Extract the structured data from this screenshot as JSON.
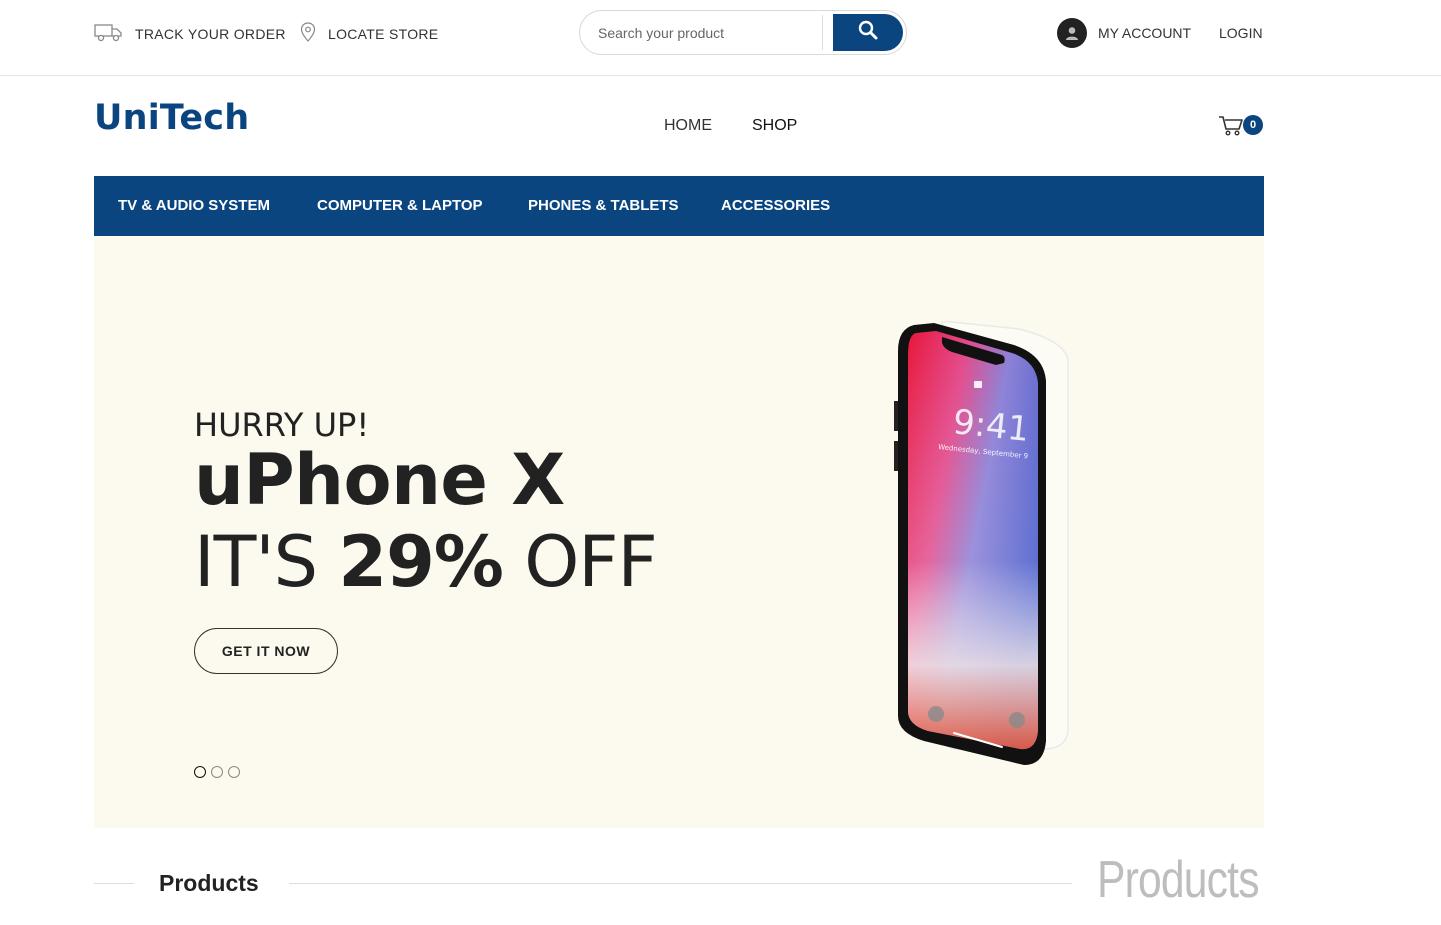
{
  "topbar": {
    "track_order": "TRACK YOUR ORDER",
    "locate_store": "LOCATE STORE",
    "search_placeholder": "Search your product",
    "my_account": "MY ACCOUNT",
    "login": "LOGIN"
  },
  "header": {
    "logo": "UniTech",
    "nav": [
      "HOME",
      "SHOP"
    ],
    "cart_count": "0"
  },
  "categories": [
    "TV & AUDIO SYSTEM",
    "COMPUTER & LAPTOP",
    "PHONES & TABLETS",
    "ACCESSORIES"
  ],
  "hero": {
    "pre_title": "HURRY UP!",
    "title": "uPhone X",
    "offer_prefix": "IT'S",
    "offer_highlight": "29%",
    "offer_suffix": "OFF",
    "cta": "GET IT NOW",
    "phone_time": "9:41",
    "phone_date": "Wednesday, September 9",
    "slides_count": 3,
    "active_slide": 1,
    "background": "#fcfaee"
  },
  "section": {
    "title": "Products",
    "ghost_title": "Products"
  },
  "colors": {
    "brand": "#0b4580",
    "text": "#222222"
  },
  "icons": [
    "truck-icon",
    "map-pin-icon",
    "search-icon",
    "user-icon",
    "cart-icon"
  ]
}
